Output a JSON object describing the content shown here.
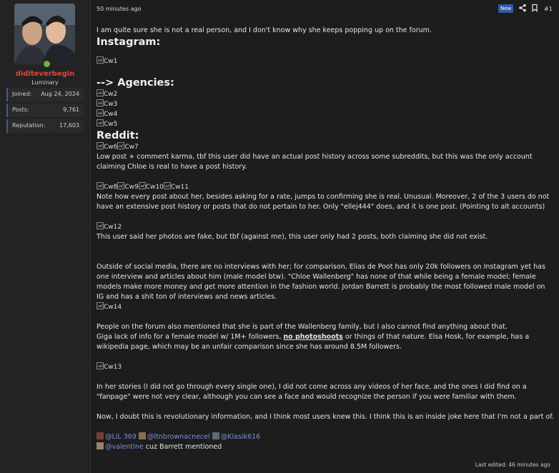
{
  "user": {
    "name": "diditeverbegin",
    "title": "Luminary",
    "stats": [
      {
        "label": "Joined:",
        "value": "Aug 24, 2024"
      },
      {
        "label": "Posts:",
        "value": "9,761"
      },
      {
        "label": "Reputation:",
        "value": "17,603"
      }
    ]
  },
  "post": {
    "time": "50 minutes ago",
    "new_badge": "New",
    "number": "#1",
    "p1": "I am quite sure she is not a real person, and I don't know why she keeps popping up on the forum.",
    "h_instagram": "Instagram:",
    "img_cw1": "Cw1",
    "h_agencies": "--> Agencies:",
    "img_cw2": "Cw2",
    "img_cw3": "Cw3",
    "img_cw4": "Cw4",
    "img_cw5": "Cw5",
    "h_reddit": "Reddit:",
    "img_cw6": "Cw6",
    "img_cw7": "Cw7",
    "p2": "Low post + comment karma, tbf this user did have an actual post history across some subreddits, but this was the only account claiming Chloe is real to have a post history.",
    "img_cw8": "Cw8",
    "img_cw9": "Cw9",
    "img_cw10": "Cw10",
    "img_cw11": "Cw11",
    "p3": "Note how every post about her, besides asking for a rate, jumps to confirming she is real. Unusual. Moreover, 2 of the 3 users do not have an extensive post history or posts that do not pertain to her. Only \"ellej444\" does, and it is one post. (Pointing to alt accounts)",
    "img_cw12": "Cw12",
    "p4": "This user said her photos are fake, but tbf (against me), this user only had 2 posts, both claiming she did not exist.",
    "p5": "Outside of social media, there are no interviews with her; for comparison, Elias de Poot has only 20k followers on Instagram yet has one interview and articles about him (male model btw). \"Chloe Wallenberg\" has none of that while being a female model; female models make more money and get more attention in the fashion world. Jordan Barrett is probably the most followed male model on IG and has a shit ton of interviews and news articles.",
    "img_cw14": "Cw14",
    "p6": "People on the forum also mentioned that she is part of the Wallenberg family, but I also cannot find anything about that.",
    "p7a": "Giga lack of info for a female model w/ 1M+ followers,",
    "p7b": "no photoshoots",
    "p7c": "or things of that nature. Elsa Hosk, for example, has a wikipedia page, which may be an unfair comparison since she has around 8.5M followers.",
    "img_cw13": "Cw13",
    "p8": "In her stories (I did not go through every single one), I did not come across any videos of her face, and the ones I did find on a \"fanpage\" were not very clear, although you can see a face and would recognize the person if you were familiar with them.",
    "p9": "Now, I doubt this is revolutionary information, and I think most users knew this. I think this is an inside joke here that I'm not a part of.",
    "mention1": "@LiL 369",
    "mention2": "@ltnbrownacnecel",
    "mention3": "@Klasik616",
    "mention4": "@valentine",
    "mention_tail": "cuz Barrett mentioned",
    "edited": "Last edited: 46 minutes ago"
  },
  "colors": {
    "background": "#1d1d1d",
    "sidebar": "#232323",
    "username": "#e0453d",
    "mention": "#7f8fd6",
    "badge": "#2f5aa8"
  }
}
